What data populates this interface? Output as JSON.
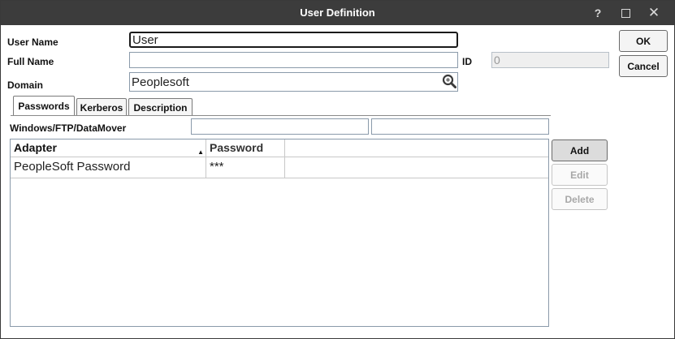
{
  "window": {
    "title": "User Definition",
    "help_label": "?",
    "close_label": "✕"
  },
  "form": {
    "user_name_label": "User Name",
    "user_name_value": "User",
    "full_name_label": "Full Name",
    "full_name_value": "",
    "id_label": "ID",
    "id_value": "0",
    "domain_label": "Domain",
    "domain_value": "Peoplesoft",
    "windows_label": "Windows/FTP/DataMover",
    "windows_field_1": "",
    "windows_field_2": ""
  },
  "tabs": [
    {
      "label": "Passwords",
      "active": true
    },
    {
      "label": "Kerberos",
      "active": false
    },
    {
      "label": "Description",
      "active": false
    }
  ],
  "grid": {
    "columns": [
      "Adapter",
      "Password",
      ""
    ],
    "sorted_column": "Adapter",
    "sort_direction": "ascending",
    "rows": [
      [
        "PeopleSoft Password",
        "***",
        ""
      ]
    ]
  },
  "buttons": {
    "ok": "OK",
    "cancel": "Cancel",
    "add": "Add",
    "edit": "Edit",
    "delete": "Delete"
  }
}
